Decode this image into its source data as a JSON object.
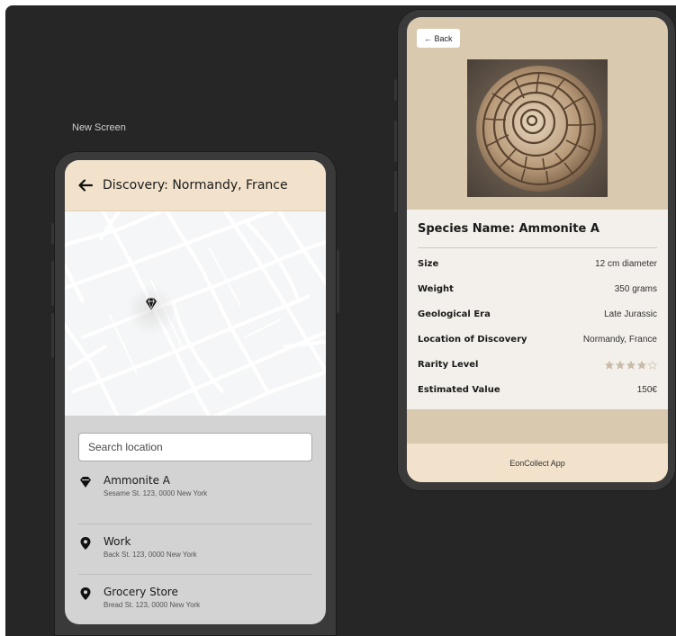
{
  "canvas": {
    "screen_label": "New Screen"
  },
  "discovery_screen": {
    "title": "Discovery: Normandy, France",
    "search": {
      "placeholder": "Search location",
      "value": ""
    },
    "locations": [
      {
        "name": "Ammonite A",
        "address": "Sesame St. 123, 0000 New York",
        "icon": "fossil-pin-icon"
      },
      {
        "name": "Work",
        "address": "Back St. 123, 0000 New York",
        "icon": "map-pin-icon"
      },
      {
        "name": "Grocery Store",
        "address": "Bread St. 123, 0000 New York",
        "icon": "map-pin-icon"
      }
    ]
  },
  "detail_screen": {
    "back_label": "← Back",
    "species_name": "Species Name: Ammonite A",
    "attributes": [
      {
        "label": "Size",
        "value": "12 cm diameter"
      },
      {
        "label": "Weight",
        "value": "350 grams"
      },
      {
        "label": "Geological Era",
        "value": "Late Jurassic"
      },
      {
        "label": "Location of Discovery",
        "value": "Normandy, France"
      },
      {
        "label": "Rarity Level",
        "stars_filled": 4,
        "stars_total": 5
      },
      {
        "label": "Estimated Value",
        "value": "150€"
      }
    ],
    "footer": "EonCollect App"
  },
  "colors": {
    "header_bg": "#f2e2cb",
    "detail_bg": "#d8c9af",
    "card_bg": "#f3efea",
    "star": "#c9bba8"
  }
}
